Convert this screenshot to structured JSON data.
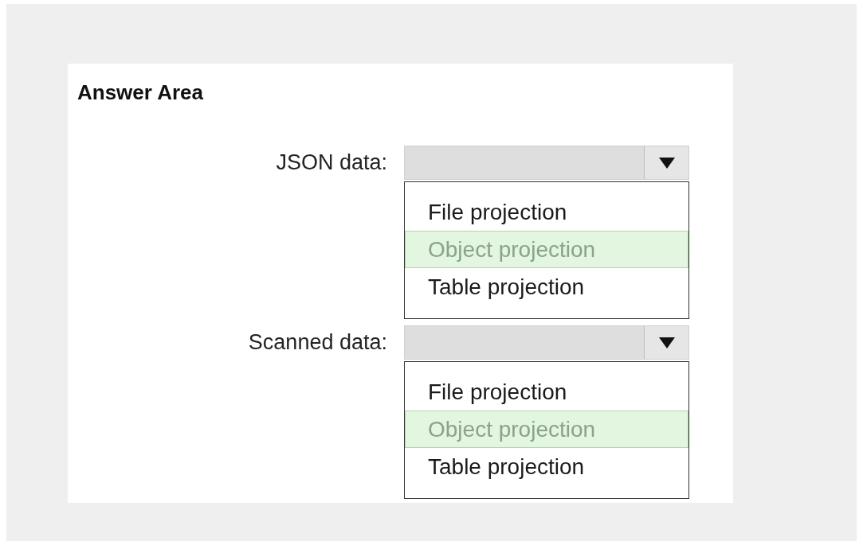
{
  "heading": "Answer Area",
  "questions": [
    {
      "label": "JSON data:",
      "options": [
        {
          "label": "File projection",
          "selected": false
        },
        {
          "label": "Object projection",
          "selected": true
        },
        {
          "label": "Table projection",
          "selected": false
        }
      ]
    },
    {
      "label": "Scanned data:",
      "options": [
        {
          "label": "File projection",
          "selected": false
        },
        {
          "label": "Object projection",
          "selected": true
        },
        {
          "label": "Table projection",
          "selected": false
        }
      ]
    }
  ]
}
